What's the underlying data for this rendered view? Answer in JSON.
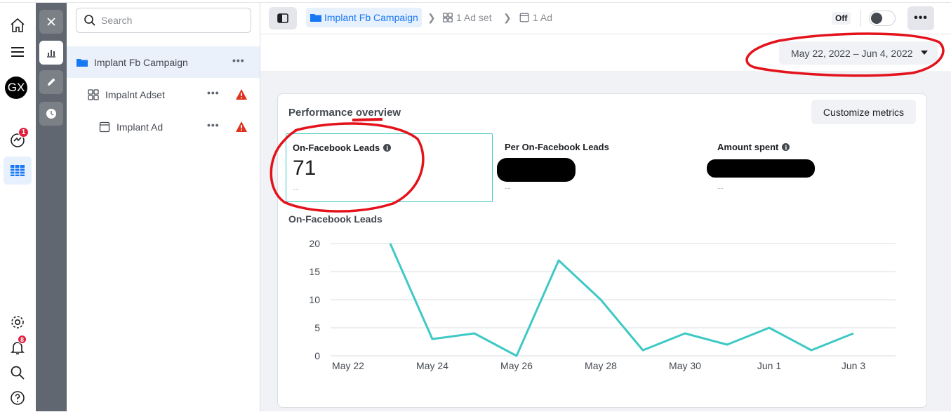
{
  "rail": {
    "avatar_initials": "GX",
    "inbox_badge": "1",
    "notifications_badge": "8"
  },
  "tree": {
    "search_placeholder": "Search",
    "items": [
      {
        "label": "Implant Fb Campaign",
        "type": "campaign",
        "icon": "folder-icon",
        "warning": false
      },
      {
        "label": "Impalnt Adset",
        "type": "adset",
        "icon": "adset-grid-icon",
        "warning": true
      },
      {
        "label": "Implant Ad",
        "type": "ad",
        "icon": "ad-frame-icon",
        "warning": true
      }
    ]
  },
  "breadcrumb": {
    "campaign": "Implant Fb Campaign",
    "adset": "1 Ad set",
    "ad": "1 Ad"
  },
  "toolbar": {
    "toggle_state": "Off"
  },
  "date_range": "May 22, 2022 – Jun 4, 2022",
  "overview": {
    "title": "Performance overview",
    "customize_label": "Customize metrics",
    "metrics": [
      {
        "label": "On-Facebook Leads",
        "value": "71",
        "compare": "--",
        "selected": true,
        "redacted": false
      },
      {
        "label": "Per On-Facebook Leads",
        "value": "",
        "compare": "--",
        "selected": false,
        "redacted": true
      },
      {
        "label": "Amount spent",
        "value": "",
        "compare": "--",
        "selected": false,
        "redacted": true
      }
    ],
    "chart_title": "On-Facebook Leads"
  },
  "colors": {
    "accent": "#1877f2",
    "line": "#3ec9c5",
    "annotation": "#e3121b",
    "warning": "#e0311f"
  },
  "chart_data": {
    "type": "line",
    "title": "On-Facebook Leads",
    "xlabel": "",
    "ylabel": "",
    "ylim": [
      0,
      20
    ],
    "yticks": [
      0,
      5,
      10,
      15,
      20
    ],
    "x": [
      "May 22",
      "May 23",
      "May 24",
      "May 25",
      "May 26",
      "May 27",
      "May 28",
      "May 29",
      "May 30",
      "May 31",
      "Jun 1",
      "Jun 2",
      "Jun 3"
    ],
    "xtick_labels": [
      "May 22",
      "May 24",
      "May 26",
      "May 28",
      "May 30",
      "Jun 1",
      "Jun 3"
    ],
    "series": [
      {
        "values": [
          null,
          20,
          3,
          4,
          0,
          17,
          10,
          1,
          4,
          2,
          5,
          1,
          4
        ]
      }
    ],
    "grid": true
  }
}
